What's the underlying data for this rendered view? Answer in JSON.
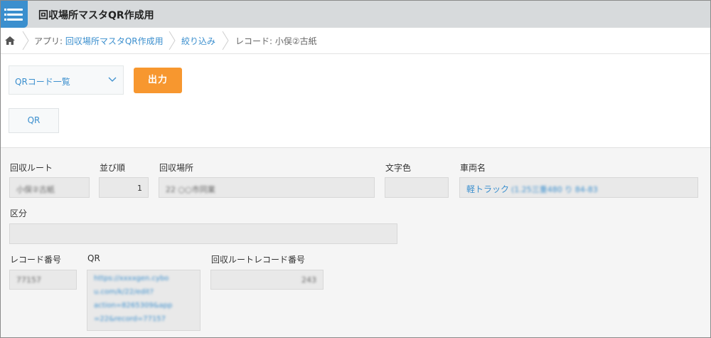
{
  "header": {
    "title": "回収場所マスタQR作成用"
  },
  "breadcrumb": {
    "app_prefix": "アプリ: ",
    "app_name": "回収場所マスタQR作成用",
    "filter": "絞り込み",
    "record": "レコード: 小俣②古紙"
  },
  "toolbar": {
    "view_select": "QRコード一覧",
    "output_button": "出力",
    "qr_button": "QR"
  },
  "fields": {
    "route": {
      "label": "回収ルート",
      "value": "小俣②古紙"
    },
    "order": {
      "label": "並び順",
      "value": "1"
    },
    "place": {
      "label": "回収場所",
      "value": "22 ○○市同業"
    },
    "text_color": {
      "label": "文字色",
      "value": ""
    },
    "vehicle": {
      "label": "車両名",
      "value": "軽トラック",
      "value_blurred": "(1.25三重480 り 84-83"
    },
    "category": {
      "label": "区分",
      "value": ""
    },
    "record_no": {
      "label": "レコード番号",
      "value": "77157"
    },
    "qr": {
      "label": "QR",
      "lines": [
        "https://xxxxgen.cybo",
        "u.com/k/22/edit?",
        "action=8265309&app",
        "=22&record=77157"
      ]
    },
    "route_record_no": {
      "label": "回収ルートレコード番号",
      "value": "243"
    }
  },
  "colors": {
    "accent": "#3b8fce",
    "output": "#f7972f",
    "header": "#d7dadc"
  }
}
